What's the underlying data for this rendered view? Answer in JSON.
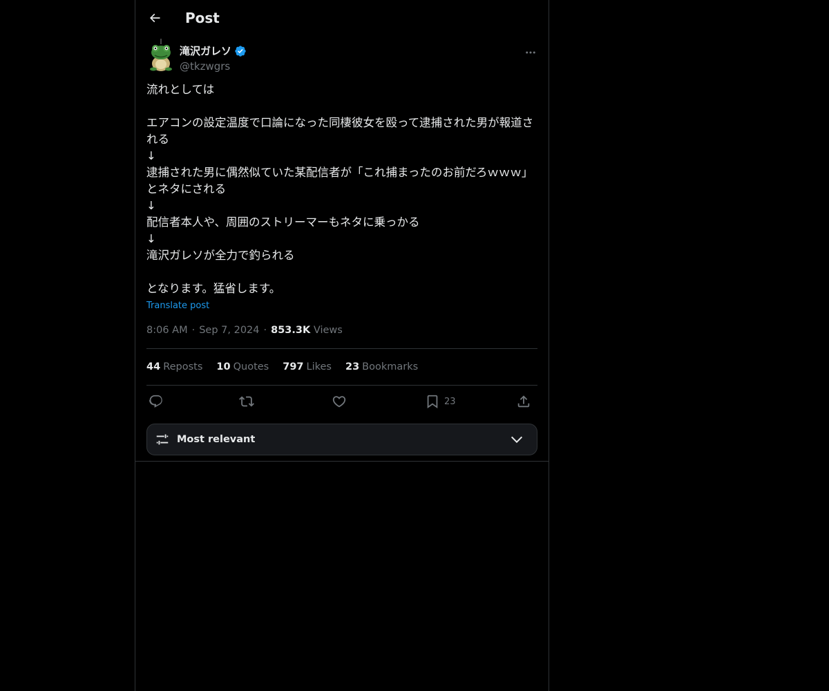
{
  "header": {
    "title": "Post"
  },
  "author": {
    "name": "滝沢ガレソ",
    "handle": "@tkzwgrs",
    "verified": true
  },
  "tweet": {
    "text": "流れとしては\n\nエアコンの設定温度で口論になった同棲彼女を殴って逮捕された男が報道される\n↓\n逮捕された男に偶然似ていた某配信者が「これ捕まったのお前だろｗｗｗ」とネタにされる\n↓\n配信者本人や、周囲のストリーマーもネタに乗っかる\n↓\n滝沢ガレソが全力で釣られる\n\nとなります。猛省します。",
    "translate_label": "Translate post"
  },
  "meta": {
    "time": "8:06 AM",
    "separator1": "·",
    "date": "Sep 7, 2024",
    "separator2": "·",
    "views_count": "853.3K",
    "views_label": "Views"
  },
  "stats": {
    "reposts_count": "44",
    "reposts_label": "Reposts",
    "quotes_count": "10",
    "quotes_label": "Quotes",
    "likes_count": "797",
    "likes_label": "Likes",
    "bookmarks_count": "23",
    "bookmarks_label": "Bookmarks"
  },
  "actions": {
    "bookmark_count": "23"
  },
  "sort": {
    "label": "Most relevant"
  },
  "colors": {
    "background": "#000000",
    "text_primary": "#e7e9ea",
    "text_secondary": "#71767b",
    "accent": "#1d9bf0",
    "border": "#2f3336"
  }
}
